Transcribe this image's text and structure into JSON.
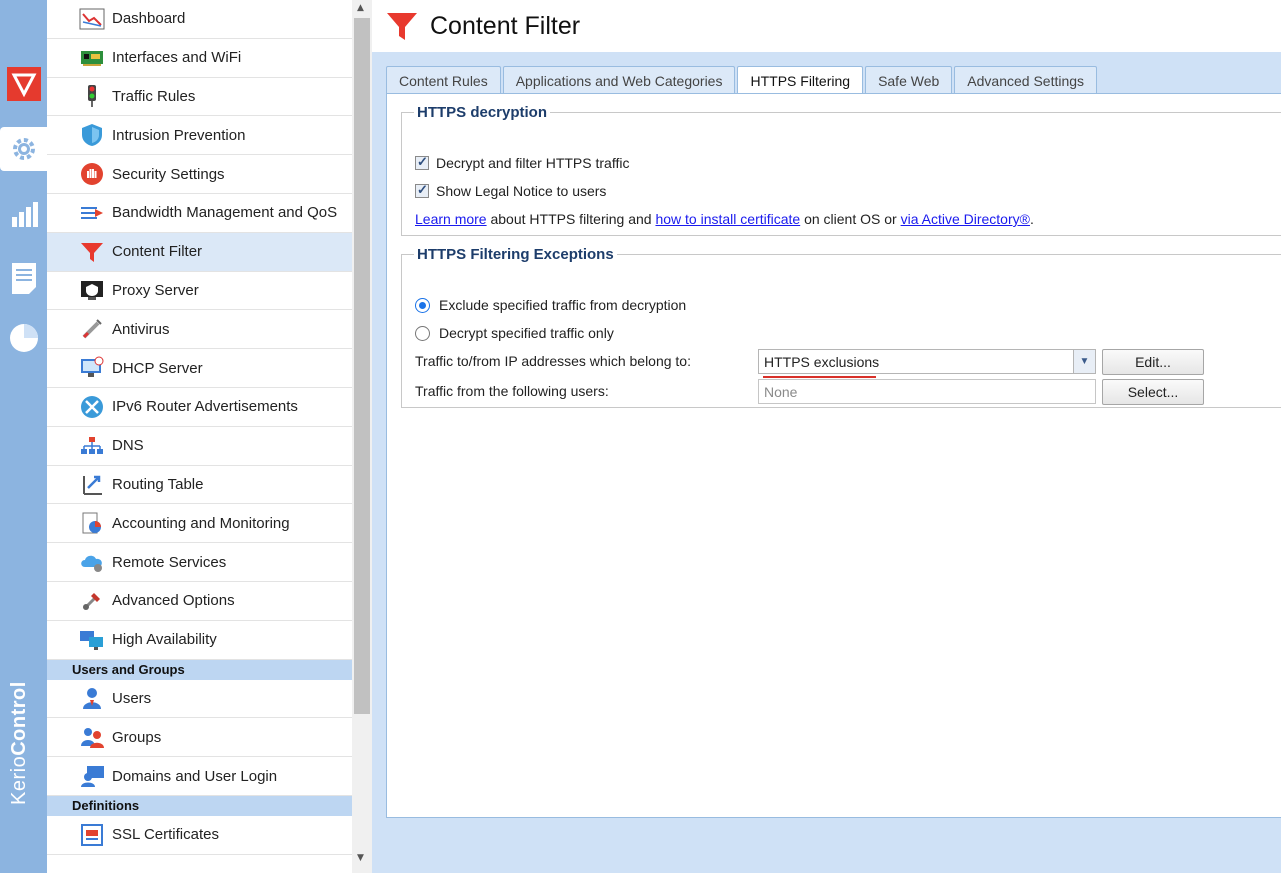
{
  "brand": {
    "prefix": "Kerio",
    "suffix": "Control"
  },
  "rail": [
    "shield-icon",
    "gear-icon",
    "bar-chart-icon",
    "log-icon",
    "pie-icon"
  ],
  "nav": {
    "items": [
      {
        "label": "Dashboard",
        "icon": "dashboard-icon"
      },
      {
        "label": "Interfaces and WiFi",
        "icon": "network-card-icon"
      },
      {
        "label": "Traffic Rules",
        "icon": "traffic-light-icon"
      },
      {
        "label": "Intrusion Prevention",
        "icon": "shield-icon"
      },
      {
        "label": "Security Settings",
        "icon": "hand-stop-icon"
      },
      {
        "label": "Bandwidth Management and QoS",
        "icon": "bandwidth-icon"
      },
      {
        "label": "Content Filter",
        "icon": "funnel-icon"
      },
      {
        "label": "Proxy Server",
        "icon": "proxy-icon"
      },
      {
        "label": "Antivirus",
        "icon": "syringe-icon"
      },
      {
        "label": "DHCP Server",
        "icon": "dhcp-icon"
      },
      {
        "label": "IPv6 Router Advertisements",
        "icon": "ipv6-icon"
      },
      {
        "label": "DNS",
        "icon": "dns-tree-icon"
      },
      {
        "label": "Routing Table",
        "icon": "routing-icon"
      },
      {
        "label": "Accounting and Monitoring",
        "icon": "accounting-icon"
      },
      {
        "label": "Remote Services",
        "icon": "cloud-icon"
      },
      {
        "label": "Advanced Options",
        "icon": "tools-icon"
      },
      {
        "label": "High Availability",
        "icon": "monitors-icon"
      }
    ],
    "section_users": "Users and Groups",
    "user_items": [
      {
        "label": "Users",
        "icon": "user-icon"
      },
      {
        "label": "Groups",
        "icon": "group-icon"
      },
      {
        "label": "Domains and User Login",
        "icon": "domain-user-icon"
      }
    ],
    "section_definitions": "Definitions",
    "def_items": [
      {
        "label": "SSL Certificates",
        "icon": "certificate-icon"
      }
    ]
  },
  "page": {
    "title": "Content Filter"
  },
  "tabs": [
    "Content Rules",
    "Applications and Web Categories",
    "HTTPS Filtering",
    "Safe Web",
    "Advanced Settings"
  ],
  "decryption": {
    "legend": "HTTPS decryption",
    "cb1": "Decrypt and filter HTTPS traffic",
    "cb2": "Show Legal Notice to users",
    "learn_more": "Learn more",
    "text1": " about HTTPS filtering and ",
    "install_cert": "how to install certificate",
    "text2": " on client OS or ",
    "via_ad": "via Active Directory®",
    "text3": "."
  },
  "exceptions": {
    "legend": "HTTPS Filtering Exceptions",
    "radio1": "Exclude specified traffic from decryption",
    "radio2": "Decrypt specified traffic only",
    "ip_label": "Traffic to/from IP addresses which belong to:",
    "ip_value": "HTTPS exclusions",
    "edit": "Edit...",
    "users_label": "Traffic from the following users:",
    "users_placeholder": "None",
    "select": "Select..."
  }
}
